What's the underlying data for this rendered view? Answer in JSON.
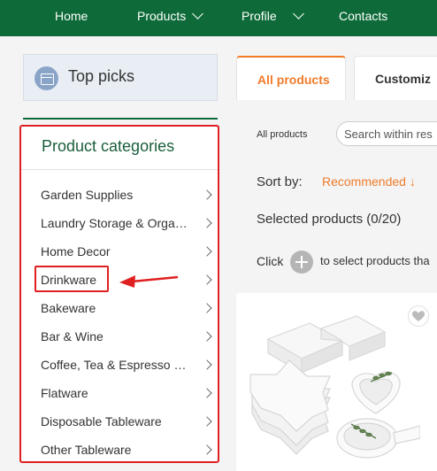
{
  "nav": {
    "home": "Home",
    "products": "Products",
    "profile": "Profile",
    "contacts": "Contacts"
  },
  "sidebar": {
    "top_picks": "Top picks",
    "categories_title": "Product categories",
    "categories": [
      "Garden Supplies",
      "Laundry Storage & Organ...",
      "Home Decor",
      "Drinkware",
      "Bakeware",
      "Bar & Wine",
      "Coffee, Tea & Espresso S...",
      "Flatware",
      "Disposable Tableware",
      "Other Tableware"
    ]
  },
  "tabs": {
    "all_products": "All products",
    "customized": "Customiz"
  },
  "filters": {
    "all_products": "All products",
    "search_placeholder": "Search within res"
  },
  "sort": {
    "label": "Sort by:",
    "value": "Recommended ↓"
  },
  "selection": {
    "text": "Selected products (0/20)",
    "click_prefix": "Click",
    "click_suffix": "to select products tha"
  },
  "colors": {
    "nav_green": "#0e6b39",
    "accent_orange": "#f07c2a",
    "annotation_red": "#e02020"
  },
  "icons": {
    "top_picks": "gallery-icon",
    "chevron": "chevron-right-icon",
    "add": "plus-circle-icon",
    "favorite": "heart-icon"
  }
}
